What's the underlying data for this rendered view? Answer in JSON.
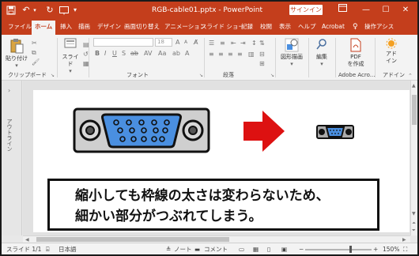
{
  "titlebar": {
    "document_title": "RGB-cable01.pptx  -  PowerPoint",
    "signin_label": "サインイン"
  },
  "tabs": [
    {
      "label": "ファイル"
    },
    {
      "label": "ホーム"
    },
    {
      "label": "挿入"
    },
    {
      "label": "描画"
    },
    {
      "label": "デザイン"
    },
    {
      "label": "画面切り替え"
    },
    {
      "label": "アニメーション"
    },
    {
      "label": "スライド ショー"
    },
    {
      "label": "記録"
    },
    {
      "label": "校閲"
    },
    {
      "label": "表示"
    },
    {
      "label": "ヘルプ"
    },
    {
      "label": "Acrobat"
    },
    {
      "label": "操作アシス"
    }
  ],
  "ribbon": {
    "paste_label": "貼り付け",
    "slide_label": "スライド",
    "font_size_value": "18",
    "shape_draw_label": "図形描画",
    "edit_label": "編集",
    "pdf_label_1": "PDF",
    "pdf_label_2": "を作成",
    "addin_label": "アド",
    "addin_label_2": "イン",
    "groups": {
      "clipboard": "クリップボード",
      "font": "フォント",
      "paragraph": "段落",
      "adobe": "Adobe Acro...",
      "addins": "アドイン"
    }
  },
  "outline_label": "アウトライン",
  "slide": {
    "caption_line1": "縮小しても枠線の太さは変わらないため、",
    "caption_line2": "細かい部分がつぶれてしまう。"
  },
  "statusbar": {
    "slide_info": "スライド 1/1",
    "language": "日本語",
    "notes_label": "ノート",
    "comments_label": "コメント",
    "zoom": "150%"
  },
  "colors": {
    "accent": "#c43e1c",
    "connector_blue": "#4a8fe0",
    "arrow_red": "#dd1111"
  }
}
